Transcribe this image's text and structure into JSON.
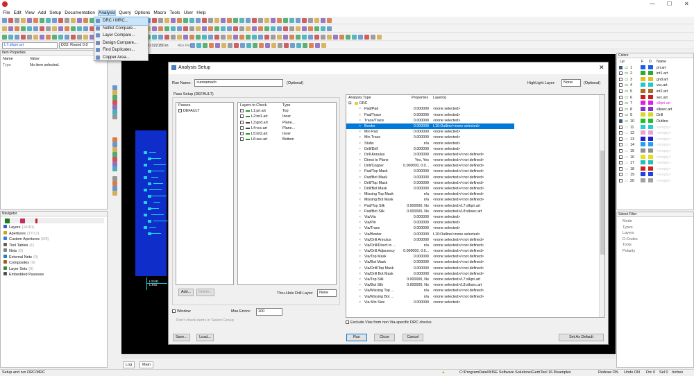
{
  "app": {
    "title_controls": [
      "—",
      "☐",
      "✕"
    ]
  },
  "menubar": [
    "File",
    "Edit",
    "View",
    "Add",
    "Setup",
    "Documentation",
    "Analysis",
    "Query",
    "Options",
    "Macro",
    "Tools",
    "User",
    "Help"
  ],
  "analysis_menu": [
    "DRC / MRC...",
    "Netlist Compare...",
    "Layer Compare...",
    "Design Compare...",
    "Find Duplicates...",
    "Copper Area..."
  ],
  "toolbar": {
    "layer_select": "L7:slkpri.art",
    "dcode": "D23: Round 0.0",
    "coord": "-0.322150 in",
    "units": "Abs Rel"
  },
  "item_properties": {
    "title": "Item Properties",
    "headers": [
      "Name",
      "Value"
    ],
    "rows": [
      [
        "Type",
        "No item selected."
      ]
    ]
  },
  "navigator": {
    "title": "Navigator",
    "items": [
      {
        "label": "Layers",
        "count": "(10/10)"
      },
      {
        "label": "Apertures",
        "count": "(17/17)"
      },
      {
        "label": "Custom Apertures",
        "count": "(0/0)"
      },
      {
        "label": "Tool Tables",
        "count": "(1)"
      },
      {
        "label": "Nets",
        "count": "(0)"
      },
      {
        "label": "External Nets",
        "count": "(0)"
      },
      {
        "label": "Composites",
        "count": "(0)"
      },
      {
        "label": "Layer Sets",
        "count": "(0)"
      },
      {
        "label": "Embedded Passives",
        "count": ""
      }
    ]
  },
  "canvas": {
    "label1": "L3:Int1",
    "label2": "L:Int1"
  },
  "bottom_tabs": [
    "Log",
    "Main"
  ],
  "colors_panel": {
    "title": "Colors",
    "headers": [
      "Lyr",
      "F",
      "D",
      "Name"
    ],
    "rows": [
      {
        "n": "1",
        "name": "pri.art",
        "color": "#1d5de8",
        "checked": true
      },
      {
        "n": "2",
        "name": "int1.art",
        "color": "#2ea82e",
        "checked": false
      },
      {
        "n": "3",
        "name": "gnd.art",
        "color": "#e0c020",
        "checked": false
      },
      {
        "n": "4",
        "name": "vcc.art",
        "color": "#1ec8d8",
        "checked": false
      },
      {
        "n": "5",
        "name": "int2.art",
        "color": "#b06a20",
        "checked": false
      },
      {
        "n": "6",
        "name": "sec.art",
        "color": "#c82020",
        "checked": false
      },
      {
        "n": "7",
        "name": "slkpri.art",
        "color": "#e020e0",
        "checked": false
      },
      {
        "n": "8",
        "name": "slksec.art",
        "color": "#8a2fcf",
        "checked": false
      },
      {
        "n": "9",
        "name": "Drill",
        "color": "#d8d820",
        "checked": false
      },
      {
        "n": "10",
        "name": "Outline",
        "color": "#20c020",
        "checked": true
      },
      {
        "n": "11",
        "name": "<empty>",
        "color": "#20d0d0",
        "checked": false
      },
      {
        "n": "12",
        "name": "<empty>",
        "color": "#f0a0d0",
        "checked": false
      },
      {
        "n": "13",
        "name": "<empty>",
        "color": "#2020d0",
        "checked": false
      },
      {
        "n": "14",
        "name": "<empty>",
        "color": "#20a0f0",
        "checked": false
      },
      {
        "n": "15",
        "name": "<empty>",
        "color": "#909090",
        "checked": false
      },
      {
        "n": "16",
        "name": "<empty>",
        "color": "#e0e020",
        "checked": false
      },
      {
        "n": "17",
        "name": "<empty>",
        "color": "#20c0c0",
        "checked": false
      },
      {
        "n": "18",
        "name": "<empty>",
        "color": "#d02020",
        "checked": false
      },
      {
        "n": "19",
        "name": "<empty>",
        "color": "#2040e0",
        "checked": false
      },
      {
        "n": "20",
        "name": "<empty>",
        "color": "#a0a0a0",
        "checked": false
      }
    ]
  },
  "select_filter": {
    "title": "Select Filter",
    "items": [
      "Mode",
      "Types",
      "Layers",
      "D-Codes",
      "Tools",
      "Polarity"
    ]
  },
  "dialog": {
    "title": "Analysis Setup",
    "run_name_label": "Run Name:",
    "run_name_value": "<unnamed>",
    "optional": "(Optional)",
    "highlight_label": "HighLight Layer:",
    "highlight_value": "None",
    "pass_setup": "Pass Setup (DEFAULT)",
    "passes_header": "Passes",
    "passes": [
      "DEFAULT"
    ],
    "layers_header": [
      "Layers to Check",
      "Type"
    ],
    "layers": [
      [
        "L1:pri.art",
        "Top"
      ],
      [
        "L2:int1.art",
        "Inner"
      ],
      [
        "L3:gnd.art",
        "Plane..."
      ],
      [
        "L4:vcc.art",
        "Plane..."
      ],
      [
        "L5:int2.art",
        "Inner"
      ],
      [
        "L6:sec.art",
        "Bottom"
      ]
    ],
    "add_label": "Add...",
    "delete_label": "Delete...",
    "thru_label": "Thru-Hole Drill Layer:",
    "thru_value": "None",
    "window_label": "Window",
    "dont_check_label": "Don't check items in Select Group",
    "max_errors_label": "Max Errors:",
    "max_errors_value": "100",
    "analysis_headers": [
      "Analysis Type",
      "Properties",
      "Layer(s)"
    ],
    "analysis_root": "DRC",
    "analysis_rows": [
      [
        "Pad/Pad",
        "0.000000",
        "<none selected>"
      ],
      [
        "Pad/Trace",
        "0.000000",
        "<none selected>"
      ],
      [
        "Trace/Trace",
        "0.000000",
        "<none selected>"
      ],
      [
        "Border",
        "0.000000",
        "L10:Outline/<none selected>"
      ],
      [
        "Min Pad",
        "0.000000",
        "<none selected>"
      ],
      [
        "Min Trace",
        "0.000000",
        "<none selected>"
      ],
      [
        "Stubs",
        "n/a",
        "<none selected>"
      ],
      [
        "Drill/Drill",
        "0.000000",
        "<none selected>"
      ],
      [
        "Drill Annulus",
        "0.000000",
        "<none selected>/<not defined>"
      ],
      [
        "Direct to Plane",
        "Yes, Yes",
        "<none selected>/<not defined>"
      ],
      [
        "Drill/Copper",
        "0.000000, 0.0...",
        "<none selected>/<not defined>"
      ],
      [
        "Pad/Top Mask",
        "0.000000",
        "<none selected>/<not defined>"
      ],
      [
        "Pad/Bot Mask",
        "0.000000",
        "<none selected>/<not defined>"
      ],
      [
        "Drill/Top Mask",
        "0.000000",
        "<none selected>/<not defined>"
      ],
      [
        "Drill/Bot Mask",
        "0.000000",
        "<none selected>/<not defined>"
      ],
      [
        "Missing Top Mask",
        "n/a",
        "<none selected>/<not defined>"
      ],
      [
        "Missing Bot Mask",
        "n/a",
        "<none selected>/<not defined>"
      ],
      [
        "Pad/Top Silk",
        "0.000000, No",
        "<none selected>/L7:slkpri.art"
      ],
      [
        "Pad/Bot Silk",
        "0.000000, No",
        "<none selected>/L8:slksec.art"
      ],
      [
        "Via/Via",
        "0.000000",
        "<none selected>"
      ],
      [
        "Via/Pin",
        "0.000000",
        "<none selected>"
      ],
      [
        "Via/Trace",
        "0.000000",
        "<none selected>"
      ],
      [
        "Via/Border",
        "0.000000",
        "L10:Outline/<none selected>"
      ],
      [
        "Via/Drill Annulus",
        "0.000000",
        "<none selected>/<not defined>"
      ],
      [
        "Via/Drill/Direct to ...",
        "n/a",
        "<none selected>/<not defined>"
      ],
      [
        "Via/Drill Adjacency",
        "0.000000, 0.0...",
        "<none selected>/<not defined>"
      ],
      [
        "Via/Top Mask",
        "0.000000",
        "<none selected>/<not defined>"
      ],
      [
        "Via/Bot Mask",
        "0.000000",
        "<none selected>/<not defined>"
      ],
      [
        "Via/Drill/Top Mask",
        "0.000000",
        "<none selected>/<not defined>"
      ],
      [
        "Via/Drill Bot Mask",
        "0.000000",
        "<none selected>/<not defined>"
      ],
      [
        "Via/Top Silk",
        "0.000000, No",
        "<none selected>/L7:slkpri.art"
      ],
      [
        "Via/Bot Silk",
        "0.000000, No",
        "<none selected>/L8:slksec.art"
      ],
      [
        "Via/Missing Top ...",
        "n/a",
        "<none selected>/<not defined>"
      ],
      [
        "Via/Missing Bot ...",
        "n/a",
        "<none selected>/<not defined>"
      ],
      [
        "Via Min Size",
        "0.000000",
        "<none selected>"
      ]
    ],
    "selected_index": 3,
    "exclude_label": "Exclude Vias from non Via-specific DRC checks",
    "save_label": "Save...",
    "load_label": "Load...",
    "run_label": "Run",
    "close_label": "Close",
    "cancel_label": "Cancel",
    "default_label": "Set As Default"
  },
  "status": {
    "left": "Setup and run DRC/MRC",
    "path": "C:\\ProgramData\\WISE Software Solutions\\GerbTool 16.8\\samples",
    "redraw": "Redraw ON",
    "undo": "Undo ON",
    "drc": "Drc 0",
    "sel": "Sel 0",
    "units": "Inches"
  }
}
